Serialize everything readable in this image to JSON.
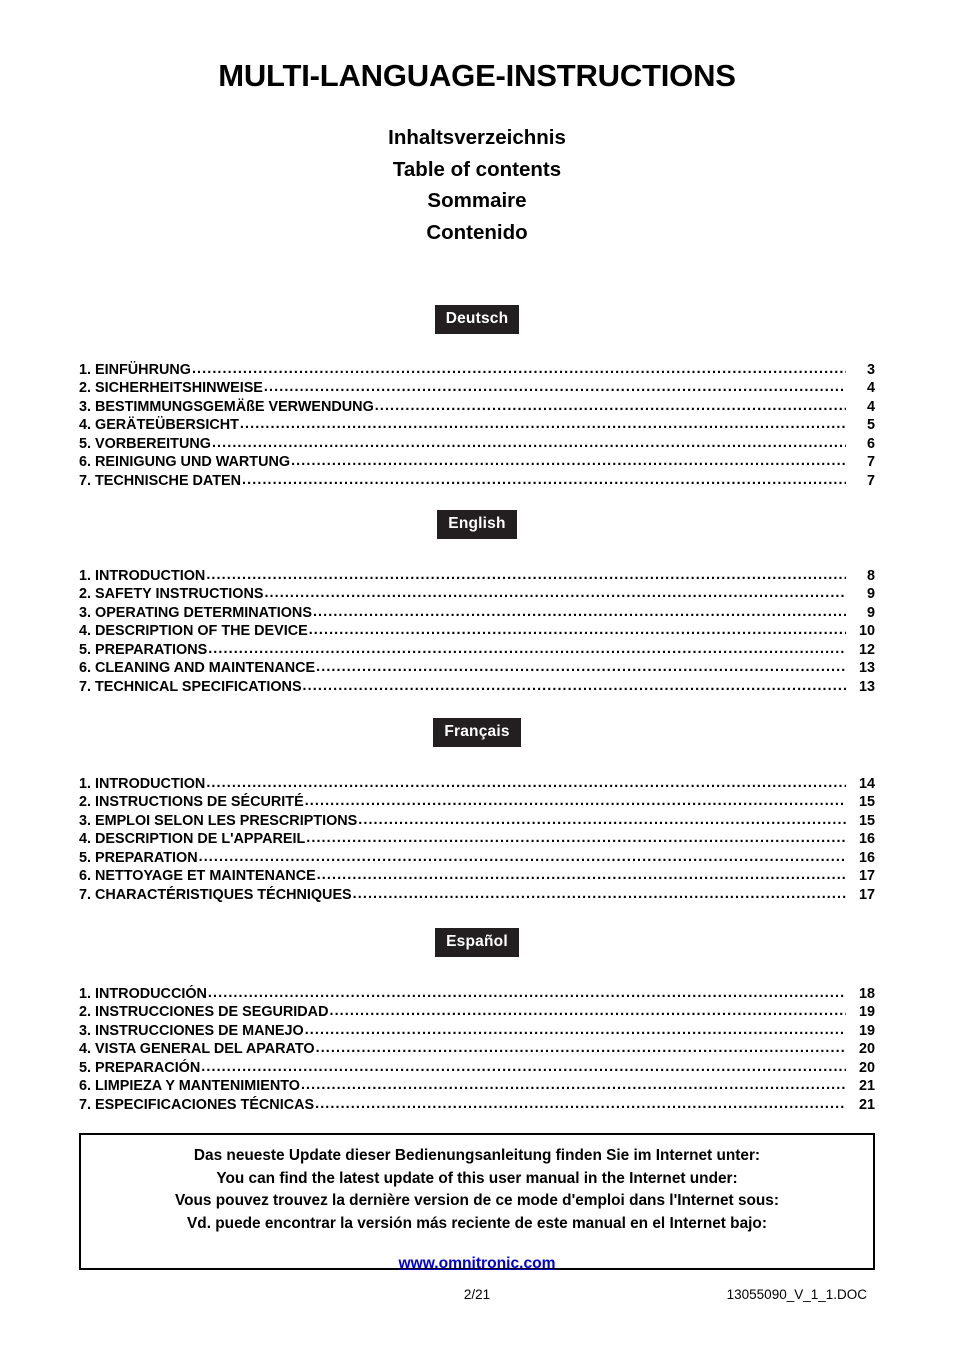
{
  "document": {
    "title": "MULTI-LANGUAGE-INSTRUCTIONS",
    "subtitles": [
      "Inhaltsverzeichnis",
      "Table of contents",
      "Sommaire",
      "Contenido"
    ]
  },
  "sections": [
    {
      "badge": "Deutsch",
      "entries": [
        {
          "label": "1. EINFÜHRUNG",
          "page": "3"
        },
        {
          "label": "2. SICHERHEITSHINWEISE",
          "page": "4"
        },
        {
          "label": "3. BESTIMMUNGSGEMÄßE VERWENDUNG",
          "page": "4"
        },
        {
          "label": "4. GERÄTEÜBERSICHT",
          "page": "5"
        },
        {
          "label": "5. VORBEREITUNG",
          "page": "6"
        },
        {
          "label": "6. REINIGUNG UND WARTUNG",
          "page": "7"
        },
        {
          "label": "7. TECHNISCHE DATEN",
          "page": "7"
        }
      ]
    },
    {
      "badge": "English",
      "entries": [
        {
          "label": "1. INTRODUCTION",
          "page": "8"
        },
        {
          "label": "2. SAFETY INSTRUCTIONS",
          "page": "9"
        },
        {
          "label": "3. OPERATING DETERMINATIONS",
          "page": "9"
        },
        {
          "label": "4. DESCRIPTION OF THE DEVICE",
          "page": "10"
        },
        {
          "label": "5. PREPARATIONS",
          "page": "12"
        },
        {
          "label": "6. CLEANING AND MAINTENANCE",
          "page": "13"
        },
        {
          "label": "7. TECHNICAL SPECIFICATIONS",
          "page": "13"
        }
      ]
    },
    {
      "badge": "Français",
      "entries": [
        {
          "label": "1. INTRODUCTION",
          "page": "14"
        },
        {
          "label": "2. INSTRUCTIONS DE SÉCURITÉ",
          "page": "15"
        },
        {
          "label": "3. EMPLOI SELON LES PRESCRIPTIONS",
          "page": "15"
        },
        {
          "label": "4. DESCRIPTION DE L'APPAREIL",
          "page": "16"
        },
        {
          "label": "5. PREPARATION",
          "page": "16"
        },
        {
          "label": "6. NETTOYAGE ET MAINTENANCE",
          "page": "17"
        },
        {
          "label": "7. CHARACTÉRISTIQUES TÉCHNIQUES",
          "page": "17"
        }
      ]
    },
    {
      "badge": "Español",
      "entries": [
        {
          "label": "1. INTRODUCCIÓN",
          "page": "18"
        },
        {
          "label": "2. INSTRUCCIONES DE SEGURIDAD",
          "page": "19"
        },
        {
          "label": "3. INSTRUCCIONES DE MANEJO",
          "page": "19"
        },
        {
          "label": "4. VISTA GENERAL DEL APARATO",
          "page": "20"
        },
        {
          "label": "5. PREPARACIÓN",
          "page": "20"
        },
        {
          "label": "6. LIMPIEZA Y MANTENIMIENTO",
          "page": "21"
        },
        {
          "label": "7. ESPECIFICACIONES TÉCNICAS",
          "page": "21"
        }
      ]
    }
  ],
  "notice": {
    "lines": [
      "Das neueste Update dieser Bedienungsanleitung finden Sie im Internet unter:",
      "You can find the latest update of this user manual in the Internet under:",
      "Vous pouvez trouvez la dernière version de ce mode d'emploi dans l'Internet sous:",
      "Vd. puede encontrar la versión más reciente de este manual en el Internet bajo:"
    ],
    "link": "www.omnitronic.com",
    "link_color": "#0000d4"
  },
  "footer": {
    "page_indicator": "2/21",
    "document_id": "13055090_V_1_1.DOC"
  }
}
